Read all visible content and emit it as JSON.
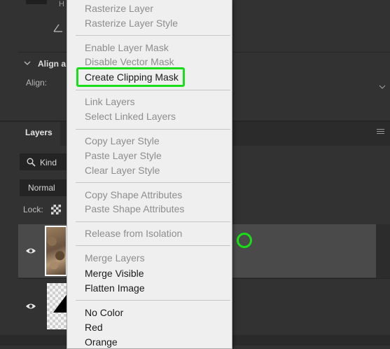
{
  "properties": {
    "header_fragment": "H",
    "align_title": "Align a",
    "align_label": "Align:"
  },
  "layers_panel": {
    "tab_label": "Layers",
    "filter_kind": "Kind",
    "blend_mode": "Normal",
    "lock_label": "Lock:"
  },
  "context_menu": {
    "items": [
      {
        "label": "Rasterize Layer",
        "enabled": false
      },
      {
        "label": "Rasterize Layer Style",
        "enabled": false
      },
      {
        "label": "Enable Layer Mask",
        "enabled": false
      },
      {
        "label": "Disable Vector Mask",
        "enabled": false
      },
      {
        "label": "Create Clipping Mask",
        "enabled": true,
        "highlighted": true
      },
      {
        "label": "Link Layers",
        "enabled": false
      },
      {
        "label": "Select Linked Layers",
        "enabled": false
      },
      {
        "label": "Copy Layer Style",
        "enabled": false
      },
      {
        "label": "Paste Layer Style",
        "enabled": false
      },
      {
        "label": "Clear Layer Style",
        "enabled": false
      },
      {
        "label": "Copy Shape Attributes",
        "enabled": false
      },
      {
        "label": "Paste Shape Attributes",
        "enabled": false
      },
      {
        "label": "Release from Isolation",
        "enabled": false
      },
      {
        "label": "Merge Layers",
        "enabled": false
      },
      {
        "label": "Merge Visible",
        "enabled": true
      },
      {
        "label": "Flatten Image",
        "enabled": true
      },
      {
        "label": "No Color",
        "enabled": true
      },
      {
        "label": "Red",
        "enabled": true
      },
      {
        "label": "Orange",
        "enabled": true
      }
    ]
  },
  "colors": {
    "highlight_outline": "#19dd19",
    "annotation_circle": "#16e016",
    "panel_bg": "#323232",
    "menu_bg": "#efefef"
  },
  "icons": [
    "angle-icon",
    "chevron-down-icon",
    "search-icon",
    "panel-menu-icon",
    "lock-transparency-icon",
    "eye-icon"
  ]
}
